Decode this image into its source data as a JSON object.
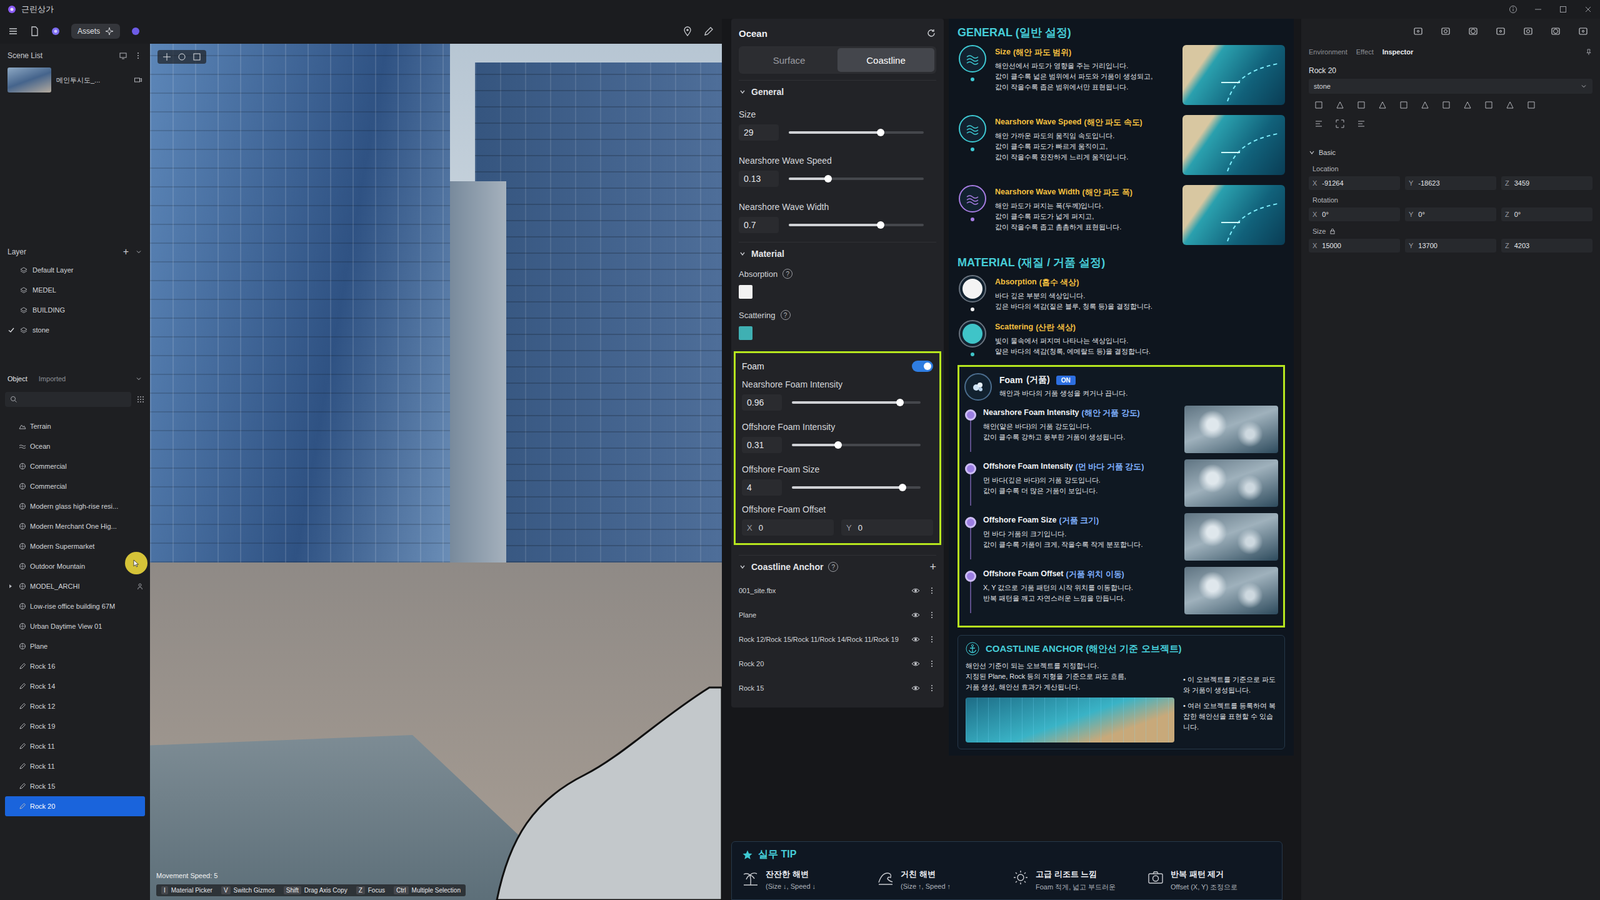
{
  "window": {
    "title": "근린상가"
  },
  "toolbar": {
    "assets": "Assets"
  },
  "scene_list": {
    "title": "Scene List",
    "items": [
      {
        "label": "메인투시도_...",
        "selected": false
      }
    ]
  },
  "layers": {
    "title": "Layer",
    "add": "+",
    "items": [
      {
        "label": "Default Layer",
        "checked": false
      },
      {
        "label": "MEDEL",
        "checked": false
      },
      {
        "label": "BUILDING",
        "checked": false
      },
      {
        "label": "stone",
        "checked": true
      }
    ]
  },
  "object_tabs": [
    {
      "label": "Object",
      "selected": true
    },
    {
      "label": "Imported",
      "selected": false
    }
  ],
  "objects": [
    {
      "label": "Terrain",
      "kind": "terrain",
      "selected": false
    },
    {
      "label": "Ocean",
      "kind": "ocean",
      "selected": false
    },
    {
      "label": "Commercial",
      "kind": "mesh",
      "selected": false
    },
    {
      "label": "Commercial",
      "kind": "mesh",
      "selected": false
    },
    {
      "label": "Modern glass high-rise resi...",
      "kind": "mesh",
      "selected": false
    },
    {
      "label": "Modern Merchant One Hig...",
      "kind": "mesh",
      "selected": false
    },
    {
      "label": "Modern Supermarket",
      "kind": "mesh",
      "selected": false
    },
    {
      "label": "Outdoor Mountain",
      "kind": "mesh",
      "selected": false
    },
    {
      "label": "MODEL_ARCHI",
      "kind": "group",
      "selected": false,
      "expanded": false
    },
    {
      "label": "Low-rise office building 67M",
      "kind": "mesh",
      "selected": false
    },
    {
      "label": "Urban Daytime View 01",
      "kind": "mesh",
      "selected": false
    },
    {
      "label": "Plane",
      "kind": "mesh",
      "selected": false
    },
    {
      "label": "Rock 16",
      "kind": "rock",
      "selected": false
    },
    {
      "label": "Rock 14",
      "kind": "rock",
      "selected": false
    },
    {
      "label": "Rock 12",
      "kind": "rock",
      "selected": false
    },
    {
      "label": "Rock 19",
      "kind": "rock",
      "selected": false
    },
    {
      "label": "Rock 11",
      "kind": "rock",
      "selected": false
    },
    {
      "label": "Rock 11",
      "kind": "rock",
      "selected": false
    },
    {
      "label": "Rock 15",
      "kind": "rock",
      "selected": false
    },
    {
      "label": "Rock 20",
      "kind": "rock",
      "selected": true
    }
  ],
  "viewport": {
    "movement": "Movement Speed: 5",
    "shortcuts": [
      {
        "key": "I",
        "label": "Material Picker"
      },
      {
        "key": "V",
        "label": "Switch Gizmos"
      },
      {
        "key": "Shift",
        "label": "Drag Axis Copy"
      },
      {
        "key": "Z",
        "label": "Focus"
      },
      {
        "key": "Ctrl",
        "label": "Multiple Selection"
      }
    ]
  },
  "ocean": {
    "title": "Ocean",
    "tabs": [
      {
        "label": "Surface",
        "selected": false
      },
      {
        "label": "Coastline",
        "selected": true
      }
    ],
    "general": {
      "title": "General",
      "expanded": true,
      "sliders": [
        {
          "label": "Size",
          "value": "29",
          "level": 0.68
        },
        {
          "label": "Nearshore Wave Speed",
          "value": "0.13",
          "level": 0.29
        },
        {
          "label": "Nearshore Wave Width",
          "value": "0.7",
          "level": 0.68
        }
      ]
    },
    "material": {
      "title": "Material",
      "expanded": true,
      "colors": [
        {
          "label": "Absorption",
          "help": "?",
          "color": "#f2f2f2"
        },
        {
          "label": "Scattering",
          "help": "?",
          "color": "#3fb0b3"
        }
      ]
    },
    "foam": {
      "label": "Foam",
      "on": true,
      "sliders": [
        {
          "label": "Nearshore Foam Intensity",
          "value": "0.96",
          "level": 0.84
        },
        {
          "label": "Offshore Foam Intensity",
          "value": "0.31",
          "level": 0.36
        },
        {
          "label": "Offshore Foam Size",
          "value": "4",
          "level": 0.86
        }
      ],
      "offset": {
        "label": "Offshore Foam Offset",
        "x_label": "X",
        "x": "0",
        "y_label": "Y",
        "y": "0"
      }
    },
    "anchors": {
      "title": "Coastline Anchor",
      "help": "?",
      "add": "+",
      "expanded": true,
      "items": [
        {
          "label": "001_site.fbx",
          "visible": true
        },
        {
          "label": "Plane",
          "visible": true
        },
        {
          "label": "Rock 12/Rock 15/Rock 11/Rock 14/Rock 11/Rock 19",
          "visible": true
        },
        {
          "label": "Rock 20",
          "visible": true
        },
        {
          "label": "Rock 15",
          "visible": true
        }
      ]
    }
  },
  "guide": {
    "general": {
      "title": "GENERAL (일반 설정)",
      "items": [
        {
          "name": "Size",
          "ko": "(해안 파도 범위)",
          "color": "#3ec9d3",
          "lines": [
            "해안선에서 파도가 영향을 주는 거리입니다.",
            "값이 클수록 넓은 범위에서 파도와 거품이 생성되고,",
            "값이 작을수록 좁은 범위에서만 표현됩니다."
          ]
        },
        {
          "name": "Nearshore Wave Speed",
          "ko": "(해안 파도 속도)",
          "color": "#3ec9d3",
          "lines": [
            "해안 가까운 파도의 움직임 속도입니다.",
            "값이 클수록 파도가 빠르게 움직이고,",
            "값이 작을수록 잔잔하게 느리게 움직입니다."
          ]
        },
        {
          "name": "Nearshore Wave Width",
          "ko": "(해안 파도 폭)",
          "color": "#a77de3",
          "lines": [
            "해안 파도가 퍼지는 폭(두께)입니다.",
            "값이 클수록 파도가 넓게 퍼지고,",
            "값이 작을수록 좁고 촘촘하게 표현됩니다."
          ]
        }
      ]
    },
    "material": {
      "title": "MATERIAL (재질 / 거품 설정)",
      "items": [
        {
          "name": "Absorption",
          "ko": "(흡수 색상)",
          "color": "#f4f4f4",
          "lines": [
            "바다 깊은 부분의 색상입니다.",
            "깊은 바다의 색감(짙은 블루, 청록 등)을 결정합니다."
          ]
        },
        {
          "name": "Scattering",
          "ko": "(산란 색상)",
          "color": "#3fc4c8",
          "lines": [
            "빛이 물속에서 퍼지며 나타나는 색상입니다.",
            "얕은 바다의 색감(청록, 에메랄드 등)을 결정합니다."
          ]
        }
      ]
    },
    "foam": {
      "name": "Foam",
      "ko": "(거품)",
      "badge": "ON",
      "desc": "해안과 바다의 거품 생성을 켜거나 끕니다.",
      "items": [
        {
          "name": "Nearshore Foam Intensity",
          "ko": "(해안 거품 강도)",
          "lines": [
            "해안(얕은 바다)의 거품 강도입니다.",
            "값이 클수록 강하고 풍부한 거품이 생성됩니다."
          ]
        },
        {
          "name": "Offshore Foam Intensity",
          "ko": "(먼 바다 거품 강도)",
          "lines": [
            "먼 바다(깊은 바다)의 거품 강도입니다.",
            "값이 클수록 더 많은 거품이 보입니다."
          ]
        },
        {
          "name": "Offshore Foam Size",
          "ko": "(거품 크기)",
          "lines": [
            "먼 바다 거품의 크기입니다.",
            "값이 클수록 거품이 크게, 작을수록 작게 분포합니다."
          ]
        },
        {
          "name": "Offshore Foam Offset",
          "ko": "(거품 위치 이동)",
          "lines": [
            "X, Y 값으로 거품 패턴의 시작 위치를 이동합니다.",
            "반복 패턴을 깨고 자연스러운 느낌을 만듭니다."
          ]
        }
      ]
    },
    "anchor": {
      "title": "COASTLINE ANCHOR (해안선 기준 오브젝트)",
      "lines": [
        "해안선 기준이 되는 오브젝트를 지정합니다.",
        "지정된 Plane, Rock 등의 지형을 기준으로 파도 흐름,",
        "거품 생성, 해안선 효과가 계산됩니다."
      ],
      "bullets": [
        "• 이 오브젝트를 기준으로 파도와 거품이 생성됩니다.",
        "• 여러 오브젝트를 등록하여 복잡한 해안선을 표현할 수 있습니다."
      ]
    },
    "tip": {
      "title": "실무 TIP",
      "items": [
        {
          "kind": "calm",
          "title": "잔잔한 해변",
          "note": "(Size ↓, Speed ↓"
        },
        {
          "kind": "rough",
          "title": "거친 해변",
          "note": "(Size ↑, Speed ↑"
        },
        {
          "kind": "resort",
          "title": "고급 리조트 느낌",
          "note": "Foam 적게, 넓고 부드러운"
        },
        {
          "kind": "pattern",
          "title": "반복 패턴 제거",
          "note": "Offset (X, Y) 조정으로"
        }
      ]
    }
  },
  "inspector": {
    "tabs": [
      {
        "label": "Environment",
        "selected": false
      },
      {
        "label": "Effect",
        "selected": false
      },
      {
        "label": "Inspector",
        "selected": true
      }
    ],
    "name": "Rock 20",
    "material": "stone",
    "section": {
      "title": "Basic",
      "expanded": true
    },
    "groups": [
      {
        "label": "Location",
        "locked": false,
        "fields": [
          {
            "axis": "X",
            "value": "-91264"
          },
          {
            "axis": "Y",
            "value": "-18623"
          },
          {
            "axis": "Z",
            "value": "3459"
          }
        ]
      },
      {
        "label": "Rotation",
        "locked": false,
        "fields": [
          {
            "axis": "X",
            "value": "0°"
          },
          {
            "axis": "Y",
            "value": "0°"
          },
          {
            "axis": "Z",
            "value": "0°"
          }
        ]
      },
      {
        "label": "Size",
        "locked": true,
        "fields": [
          {
            "axis": "X",
            "value": "15000"
          },
          {
            "axis": "Y",
            "value": "13700"
          },
          {
            "axis": "Z",
            "value": "4203"
          }
        ]
      }
    ]
  }
}
